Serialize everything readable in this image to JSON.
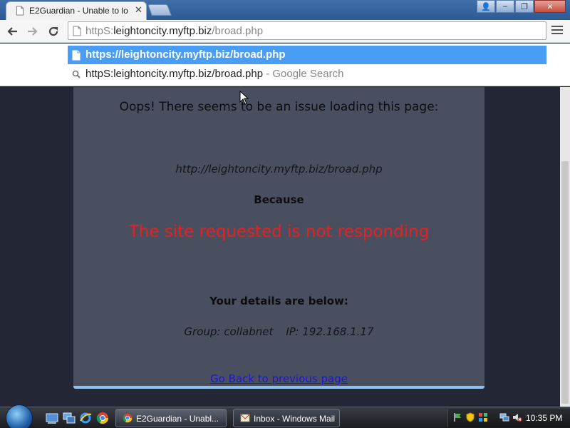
{
  "window": {
    "tab_title": "E2Guardian - Unable to lo",
    "tab_close": "✕",
    "controls": {
      "user": "👤",
      "minimize": "–",
      "maximize": "❐",
      "close": "✕"
    }
  },
  "toolbar": {
    "back_icon": "arrow-left-icon",
    "forward_icon": "arrow-right-icon",
    "reload_icon": "reload-icon",
    "address": {
      "scheme": "httpS:",
      "host": "leightoncity.myftp.biz",
      "path": "/broad.php"
    },
    "menu_icon": "hamburger-menu-icon"
  },
  "dropdown": {
    "suggestions": [
      {
        "text": "https://leightoncity.myftp.biz/broad.php",
        "suffix": "",
        "icon": "page-icon"
      },
      {
        "text": "httpS:leightoncity.myftp.biz/broad.php",
        "suffix": " - Google Search",
        "icon": "search-icon"
      }
    ]
  },
  "page": {
    "heading": "Oops! There seems to be an issue loading this page:",
    "url": "http://leightoncity.myftp.biz/broad.php",
    "because": "Because",
    "error": "The site requested is not responding",
    "details_heading": "Your details are below:",
    "group": "Group: collabnet",
    "ip": "IP: 192.168.1.17",
    "back_link": "Go Back to previous page"
  },
  "taskbar": {
    "tasks": [
      {
        "label": "E2Guardian - Unabl...",
        "active": true
      },
      {
        "label": "Inbox - Windows Mail",
        "active": false
      }
    ],
    "clock": "10:35 PM"
  },
  "colors": {
    "panel_bg": "#4a4f60",
    "error_red": "#e62020",
    "link_blue": "#1a1ac8",
    "selection_blue": "#4a9df5"
  }
}
